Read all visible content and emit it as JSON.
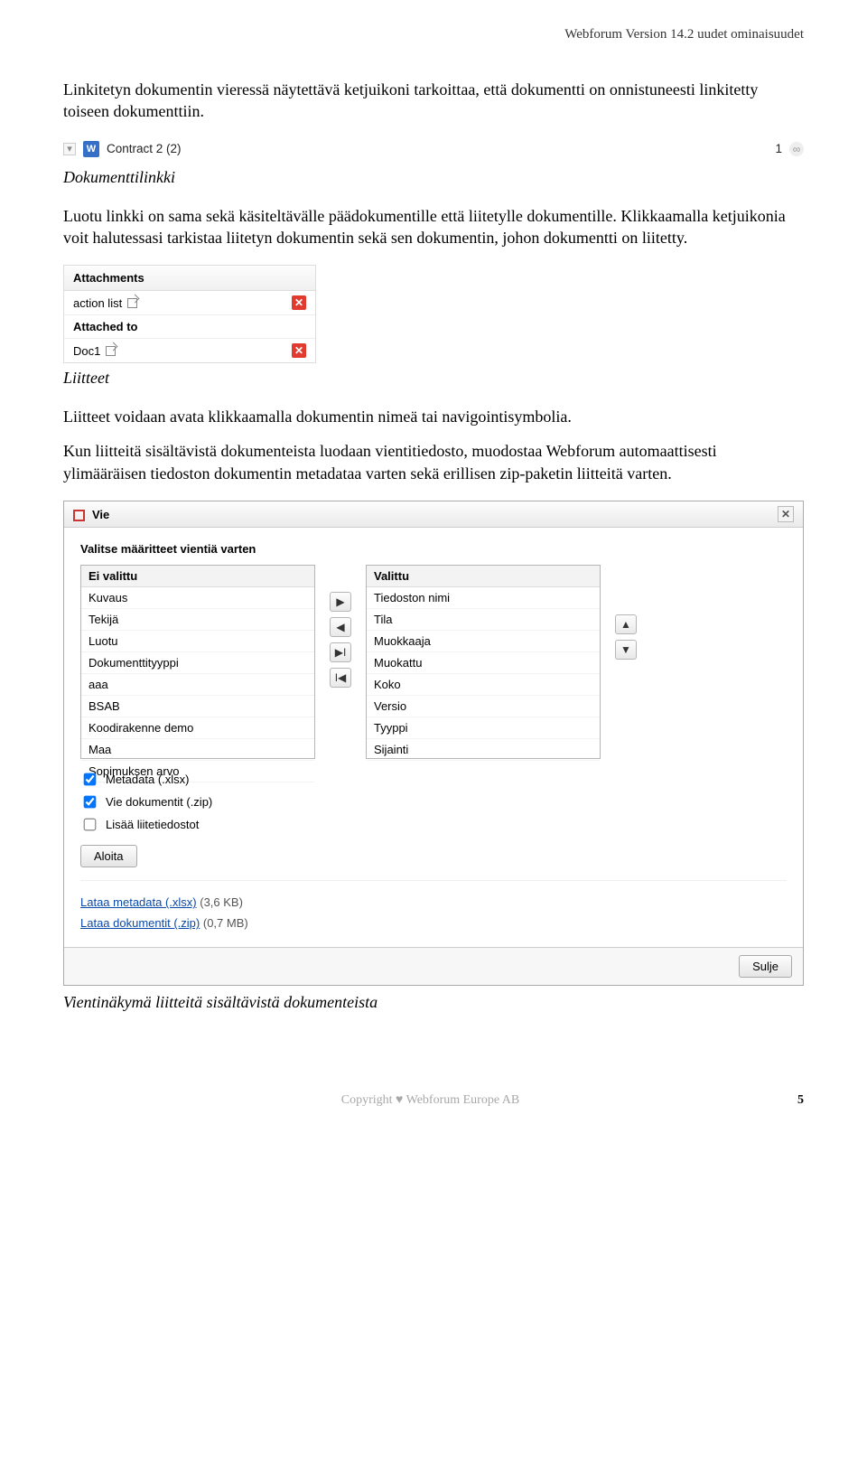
{
  "header": "Webforum  Version 14.2 uudet ominaisuudet",
  "para1": "Linkitetyn dokumentin vieressä näytettävä ketjuikoni tarkoittaa, että dokumentti on onnistuneesti linkitetty toiseen dokumenttiin.",
  "docrow": {
    "name": "Contract 2 (2)",
    "count": "1"
  },
  "caption1": "Dokumenttilinkki",
  "para2": "Luotu linkki on sama sekä käsiteltävälle päädokumentille että liitetylle dokumentille. Klikkaamalla ketjuikonia voit halutessasi tarkistaa liitetyn dokumentin sekä sen dokumentin, johon dokumentti on liitetty.",
  "attach": {
    "title": "Attachments",
    "item1": "action list",
    "sub": "Attached to",
    "item2": "Doc1"
  },
  "caption2": "Liitteet",
  "para3": "Liitteet voidaan avata klikkaamalla dokumentin nimeä tai navigointisymbolia.",
  "para4": "Kun liitteitä sisältävistä dokumenteista luodaan vientitiedosto, muodostaa Webforum automaattisesti ylimääräisen tiedoston dokumentin metadataa varten sekä erillisen zip-paketin liitteitä varten.",
  "export": {
    "title": "Vie",
    "subhdr": "Valitse määritteet vientiä varten",
    "left_header": "Ei valittu",
    "left": [
      "Kuvaus",
      "Tekijä",
      "Luotu",
      "Dokumenttityyppi",
      "aaa",
      "BSAB",
      "Koodirakenne demo",
      "Maa",
      "Sopimuksen arvo"
    ],
    "right_header": "Valittu",
    "right": [
      "Tiedoston nimi",
      "Tila",
      "Muokkaaja",
      "Muokattu",
      "Koko",
      "Versio",
      "Tyyppi",
      "Sijainti"
    ],
    "chk1": "Metadata (.xlsx)",
    "chk2": "Vie dokumentit (.zip)",
    "chk3": "Lisää liitetiedostot",
    "start": "Aloita",
    "link1": "Lataa metadata (.xlsx)",
    "size1": "(3,6 KB)",
    "link2": "Lataa dokumentit (.zip)",
    "size2": "(0,7 MB)",
    "close": "Sulje"
  },
  "caption3": "Vientinäkymä liitteitä sisältävistä dokumenteista",
  "footer": {
    "copyright": "Copyright",
    "company": "Webforum Europe AB",
    "page": "5"
  }
}
